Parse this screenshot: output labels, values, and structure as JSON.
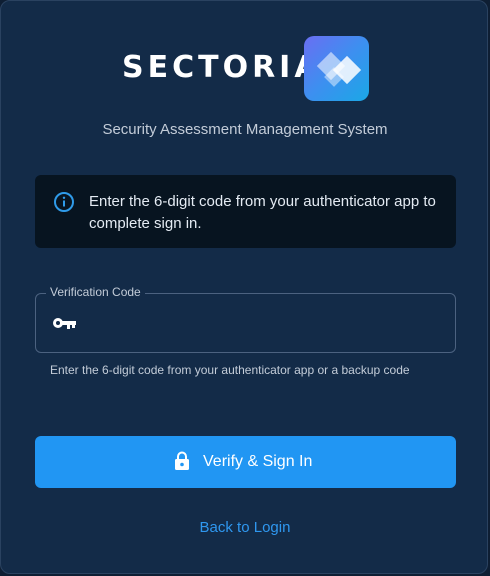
{
  "brand": {
    "name": "SECTORIA",
    "subtitle": "Security Assessment Management System"
  },
  "info": {
    "icon": "info-circle-icon",
    "message": "Enter the 6-digit code from your authenticator app to complete sign in."
  },
  "verification_field": {
    "label": "Verification Code",
    "icon": "key-icon",
    "value": "",
    "placeholder": "",
    "helper": "Enter the 6-digit code from your authenticator app or a backup code"
  },
  "actions": {
    "verify_label": "Verify & Sign In",
    "verify_icon": "lock-icon",
    "back_label": "Back to Login"
  },
  "colors": {
    "background": "#132b48",
    "primary": "#2196f3",
    "link": "#2f97ef",
    "info_bg": "#071420"
  }
}
